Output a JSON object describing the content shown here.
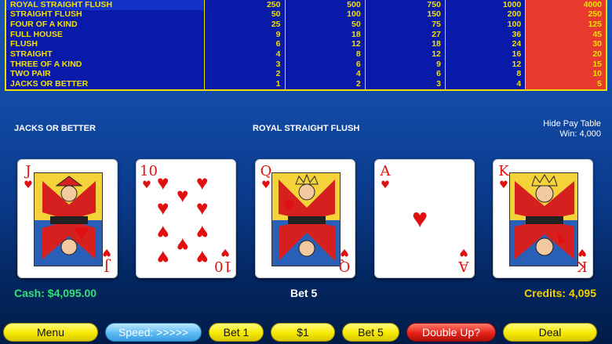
{
  "paytable": {
    "rows": [
      {
        "hand": "ROYAL STRAIGHT FLUSH",
        "pays": [
          "250",
          "500",
          "750",
          "1000",
          "4000"
        ]
      },
      {
        "hand": "STRAIGHT FLUSH",
        "pays": [
          "50",
          "100",
          "150",
          "200",
          "250"
        ]
      },
      {
        "hand": "FOUR OF A KIND",
        "pays": [
          "25",
          "50",
          "75",
          "100",
          "125"
        ]
      },
      {
        "hand": "FULL HOUSE",
        "pays": [
          "9",
          "18",
          "27",
          "36",
          "45"
        ]
      },
      {
        "hand": "FLUSH",
        "pays": [
          "6",
          "12",
          "18",
          "24",
          "30"
        ]
      },
      {
        "hand": "STRAIGHT",
        "pays": [
          "4",
          "8",
          "12",
          "16",
          "20"
        ]
      },
      {
        "hand": "THREE OF A KIND",
        "pays": [
          "3",
          "6",
          "9",
          "12",
          "15"
        ]
      },
      {
        "hand": "TWO PAIR",
        "pays": [
          "2",
          "4",
          "6",
          "8",
          "10"
        ]
      },
      {
        "hand": "JACKS OR BETTER",
        "pays": [
          "1",
          "2",
          "3",
          "4",
          "5"
        ]
      }
    ],
    "highlight_color": "#e8392f",
    "text_color": "#f2e000"
  },
  "game_name": "JACKS OR BETTER",
  "result": "ROYAL STRAIGHT FLUSH",
  "hide_pay_table": "Hide Pay Table",
  "win": "Win: 4,000",
  "cards": [
    {
      "rank": "J",
      "suit": "♥",
      "kind": "face"
    },
    {
      "rank": "10",
      "suit": "♥",
      "kind": "pips"
    },
    {
      "rank": "Q",
      "suit": "♥",
      "kind": "face"
    },
    {
      "rank": "A",
      "suit": "♥",
      "kind": "ace"
    },
    {
      "rank": "K",
      "suit": "♥",
      "kind": "face"
    }
  ],
  "status": {
    "cash": "Cash: $4,095.00",
    "bet": "Bet 5",
    "credits": "Credits: 4,095"
  },
  "buttons": {
    "menu": "Menu",
    "speed": "Speed: >>>>>",
    "bet1": "Bet 1",
    "denom": "$1",
    "bet5": "Bet 5",
    "double_up": "Double Up?",
    "deal": "Deal"
  }
}
